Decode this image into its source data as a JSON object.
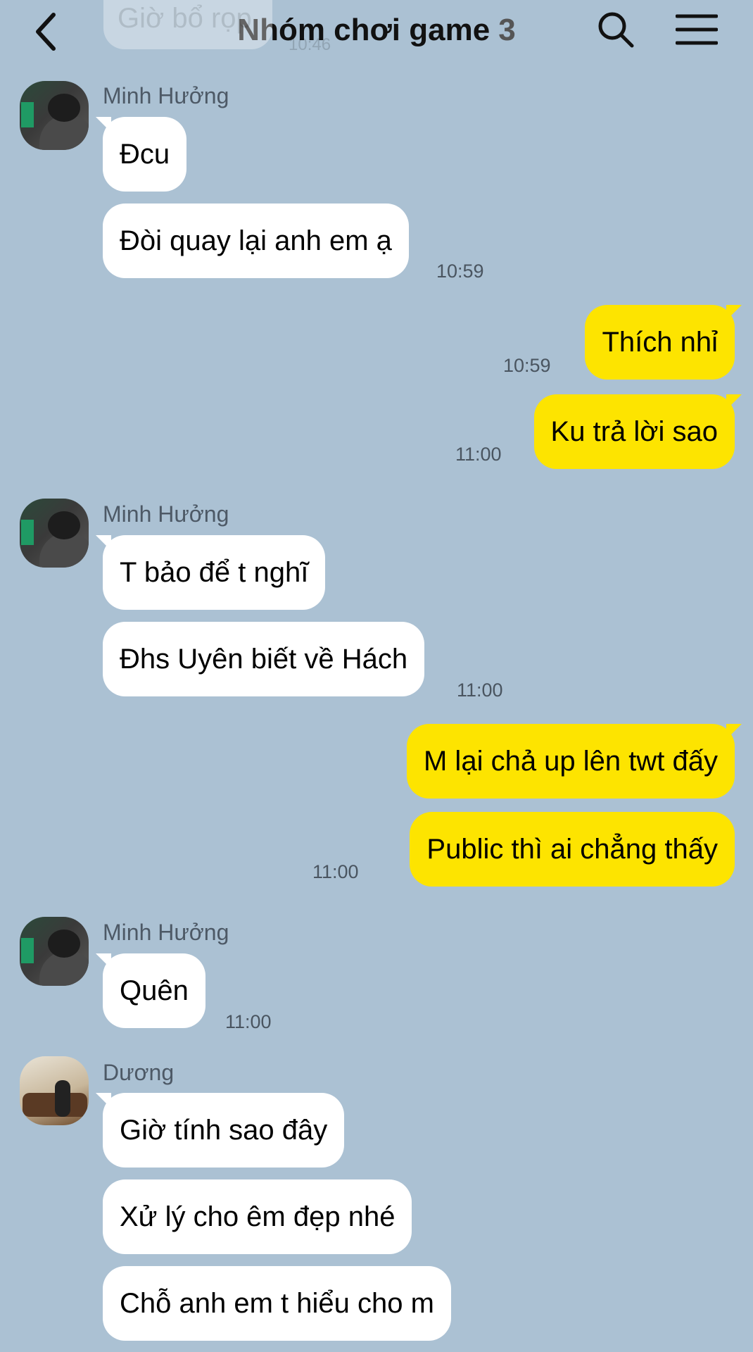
{
  "header": {
    "title": "Nhóm chơi game",
    "member_count": "3",
    "back_icon": "chevron-left-icon",
    "search_icon": "search-icon",
    "menu_icon": "hamburger-menu-icon"
  },
  "faded_message": {
    "text": "Giờ bổ rọp",
    "time": "10:46"
  },
  "groups": [
    {
      "sender": "Minh Hưởng",
      "messages": [
        "Đcu",
        "Đòi quay lại anh em ạ"
      ],
      "time": "10:59"
    },
    {
      "sender": "me",
      "messages": [
        "Thích nhỉ"
      ],
      "time": "10:59"
    },
    {
      "sender": "me",
      "messages": [
        "Ku trả lời sao"
      ],
      "time": "11:00"
    },
    {
      "sender": "Minh Hưởng",
      "messages": [
        "T bảo để t nghĩ",
        "Đhs Uyên biết về Hách"
      ],
      "time": "11:00"
    },
    {
      "sender": "me",
      "messages": [
        "M lại chả up lên twt đấy",
        "Public thì ai chẳng thấy"
      ],
      "time": "11:00"
    },
    {
      "sender": "Minh Hưởng",
      "messages": [
        "Quên"
      ],
      "time": "11:00"
    },
    {
      "sender": "Dương",
      "messages": [
        "Giờ tính sao đây",
        "Xử lý cho êm đẹp nhé",
        "Chỗ anh em t hiểu cho m"
      ]
    }
  ],
  "colors": {
    "background": "#abc1d3",
    "incoming_bubble": "#ffffff",
    "outgoing_bubble": "#fde400"
  }
}
